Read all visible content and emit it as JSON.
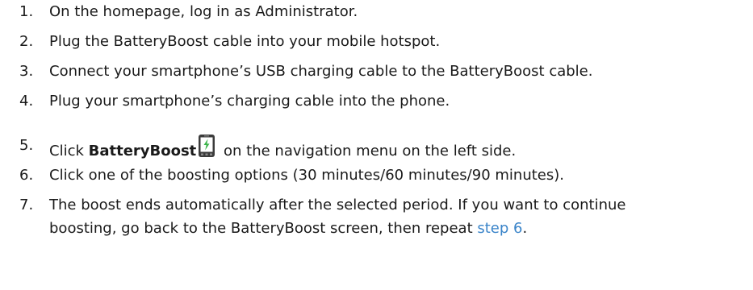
{
  "steps": [
    {
      "number": "1.",
      "text": "On the homepage, log in as Administrator."
    },
    {
      "number": "2.",
      "text": "Plug the BatteryBoost cable into your mobile hotspot."
    },
    {
      "number": "3.",
      "text": "Connect your smartphone’s USB charging cable to the BatteryBoost cable."
    },
    {
      "number": "4.",
      "text": "Plug your smartphone’s charging cable into the phone."
    },
    {
      "number": "5.",
      "prefix": "Click ",
      "bold": "BatteryBoost",
      "suffix": " on the navigation menu on the left side.",
      "icon": "battery-boost-phone-icon"
    },
    {
      "number": "6.",
      "text": "Click one of the boosting options (30 minutes/60 minutes/90 minutes)."
    },
    {
      "number": "7.",
      "line1": "The boost ends automatically after the selected period. If you want to continue",
      "line2_prefix": "boosting, go back to the BatteryBoost screen, then repeat ",
      "link": "step 6",
      "line2_suffix": "."
    }
  ],
  "colors": {
    "text": "#1a1a1a",
    "link": "#3a84c9",
    "icon_green": "#3cb44a"
  }
}
